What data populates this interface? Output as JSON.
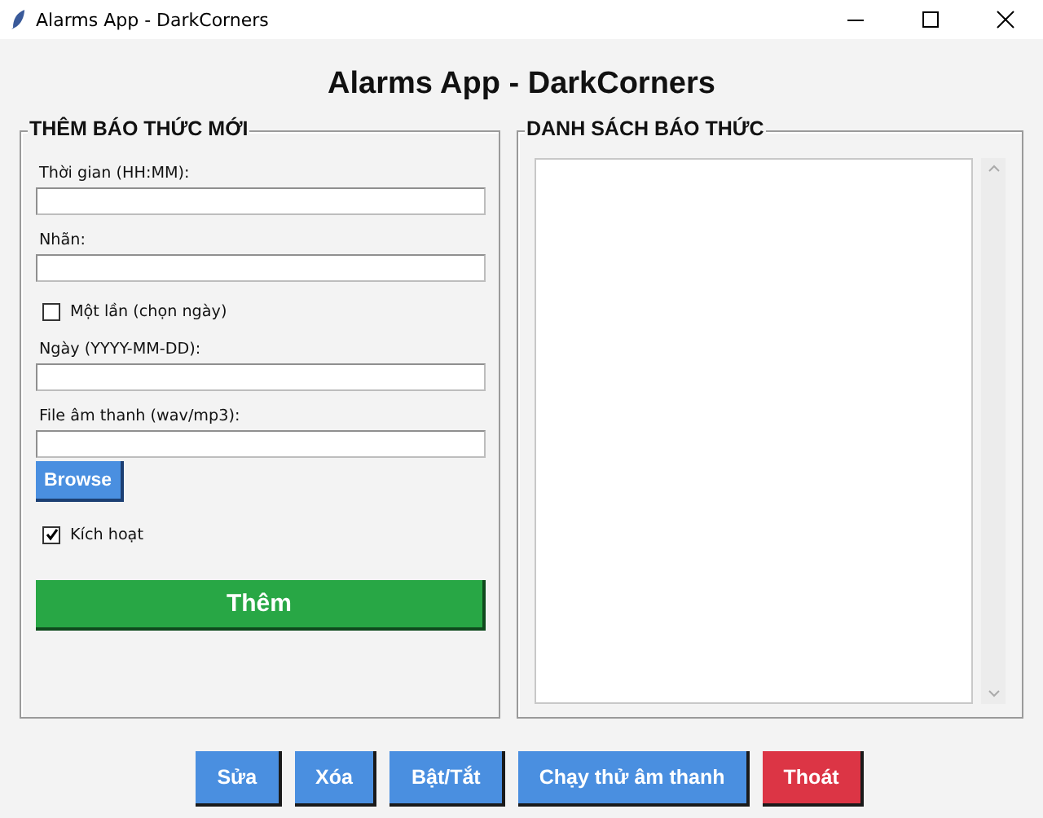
{
  "window": {
    "title": "Alarms App - DarkCorners"
  },
  "heading": "Alarms App - DarkCorners",
  "form": {
    "title": "THÊM BÁO THỨC MỚI",
    "items": [
      {
        "kind": "field",
        "label": "Thời gian (HH:MM):"
      },
      {
        "kind": "field",
        "label": "Nhãn:"
      },
      {
        "kind": "checkbox",
        "label": "Một lần (chọn ngày)",
        "checked": false
      },
      {
        "kind": "field",
        "label": "Ngày (YYYY-MM-DD):"
      },
      {
        "kind": "field",
        "label": "File âm thanh (wav/mp3):"
      },
      {
        "kind": "button",
        "label": "Browse"
      },
      {
        "kind": "checkbox",
        "label": "Kích hoạt",
        "checked": true
      }
    ],
    "submit": "Thêm"
  },
  "list_panel": {
    "title": "DANH SÁCH BÁO THỨC"
  },
  "actions": [
    {
      "label": "Sửa",
      "kind": "primary"
    },
    {
      "label": "Xóa",
      "kind": "primary"
    },
    {
      "label": "Bật/Tắt",
      "kind": "primary"
    },
    {
      "label": "Chạy thử âm thanh",
      "kind": "primary"
    },
    {
      "label": "Thoát",
      "kind": "danger"
    }
  ]
}
